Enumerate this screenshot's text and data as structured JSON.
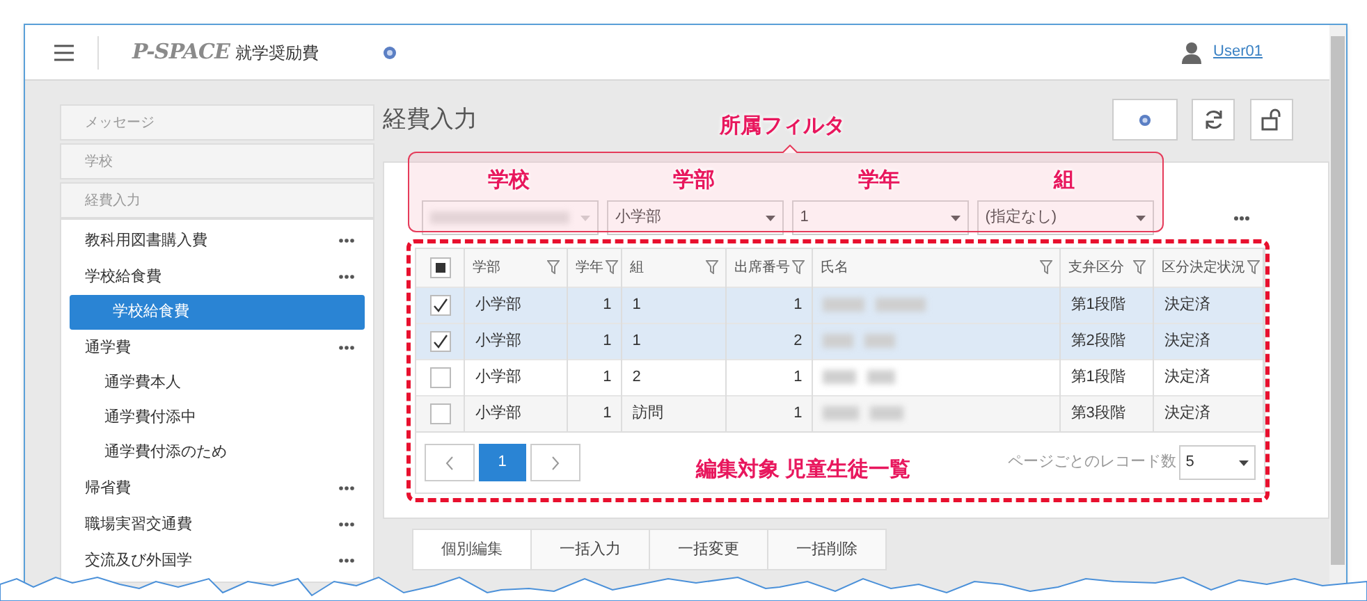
{
  "header": {
    "logo": "P-SPACE",
    "app_name": "就学奨励費",
    "user": "User01"
  },
  "sidebar": {
    "sections": [
      "メッセージ",
      "学校",
      "経費入力"
    ],
    "items": [
      {
        "label": "教科用図書購入費",
        "selected": false
      },
      {
        "label": "学校給食費",
        "selected": false,
        "children": [
          {
            "label": "学校給食費",
            "selected": true
          }
        ]
      },
      {
        "label": "通学費",
        "selected": false,
        "children": [
          {
            "label": "通学費本人",
            "selected": false
          },
          {
            "label": "通学費付添中",
            "selected": false
          },
          {
            "label": "通学費付添のため",
            "selected": false
          }
        ]
      },
      {
        "label": "帰省費",
        "selected": false
      },
      {
        "label": "職場実習交通費",
        "selected": false
      },
      {
        "label": "交流及び外国学",
        "selected": false
      }
    ]
  },
  "page_title": "経費入力",
  "filters": [
    {
      "kind": "redacted"
    },
    {
      "kind": "select",
      "value": "小学部"
    },
    {
      "kind": "select",
      "value": "1"
    },
    {
      "kind": "select",
      "value": "(指定なし)"
    }
  ],
  "table": {
    "header_checkbox_partial": true,
    "columns": [
      {
        "label": "学部",
        "kind": "text"
      },
      {
        "label": "学年",
        "kind": "number"
      },
      {
        "label": "組",
        "kind": "text"
      },
      {
        "label": "出席番号",
        "kind": "number"
      },
      {
        "label": "氏名",
        "kind": "redacted"
      },
      {
        "label": "支弁区分",
        "kind": "text"
      },
      {
        "label": "区分決定状況",
        "kind": "text"
      }
    ],
    "rows": [
      {
        "checked": true,
        "cells": [
          "小学部",
          "1",
          "1",
          "1",
          "",
          "第1段階",
          "決定済"
        ]
      },
      {
        "checked": true,
        "cells": [
          "小学部",
          "1",
          "1",
          "2",
          "",
          "第2段階",
          "決定済"
        ]
      },
      {
        "checked": false,
        "cells": [
          "小学部",
          "1",
          "2",
          "1",
          "",
          "第1段階",
          "決定済"
        ]
      },
      {
        "checked": false,
        "cells": [
          "小学部",
          "1",
          "訪問",
          "1",
          "",
          "第3段階",
          "決定済"
        ]
      }
    ]
  },
  "pagination": {
    "pages": [
      {
        "label": "1",
        "selected": true
      }
    ],
    "page_size_label": "ページごとのレコード数",
    "page_size": "5"
  },
  "action_tabs": [
    {
      "label": "個別編集",
      "selected": true
    },
    {
      "label": "一括入力",
      "selected": false
    },
    {
      "label": "一括変更",
      "selected": false
    },
    {
      "label": "一括削除",
      "selected": false
    }
  ],
  "annotations": {
    "filter_title": "所属フィルタ",
    "filter_labels": [
      "学校",
      "学部",
      "学年",
      "組"
    ],
    "table_title": "編集対象 児童生徒一覧"
  }
}
